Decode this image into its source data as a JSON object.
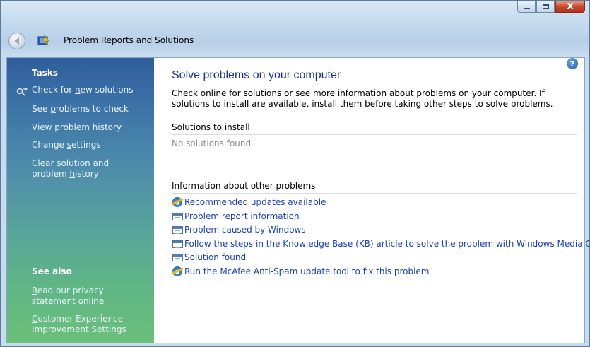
{
  "window": {
    "title": "Problem Reports and Solutions",
    "caption_buttons": {
      "minimize": "minimize",
      "maximize": "maximize",
      "close": "X"
    }
  },
  "sidebar": {
    "tasks_header": "Tasks",
    "tasks": [
      {
        "pre": "Check for ",
        "key": "n",
        "post": "ew solutions"
      },
      {
        "pre": "See ",
        "key": "p",
        "post": "roblems to check"
      },
      {
        "pre": "",
        "key": "V",
        "post": "iew problem history"
      },
      {
        "pre": "Change ",
        "key": "s",
        "post": "ettings"
      },
      {
        "pre": "Clear solution and problem ",
        "key": "h",
        "post": "istory"
      }
    ],
    "see_also_header": "See also",
    "see_also": [
      {
        "pre": "",
        "key": "R",
        "post": "ead our privacy statement online"
      },
      {
        "pre": "",
        "key": "C",
        "post": "ustomer Experience Improvement Settings"
      }
    ]
  },
  "main": {
    "heading": "Solve problems on your computer",
    "intro": "Check online for solutions or see more information about problems on your computer. If solutions to install are available, install them before taking other steps to solve problems.",
    "solutions_header": "Solutions to install",
    "solutions_empty": "No solutions found",
    "other_header": "Information about other problems",
    "other_items": [
      {
        "label": "Recommended updates available",
        "icon": "ie-icon"
      },
      {
        "label": "Problem report information",
        "icon": "report-icon"
      },
      {
        "label": "Problem caused by Windows",
        "icon": "report-icon"
      },
      {
        "label": "Follow the steps in the Knowledge Base (KB) article to solve the problem with Windows Media Center",
        "icon": "report-icon"
      },
      {
        "label": "Solution found",
        "icon": "report-icon"
      },
      {
        "label": "Run the McAfee Anti-Spam update tool to fix this problem",
        "icon": "ie-icon"
      }
    ],
    "help_glyph": "?"
  }
}
